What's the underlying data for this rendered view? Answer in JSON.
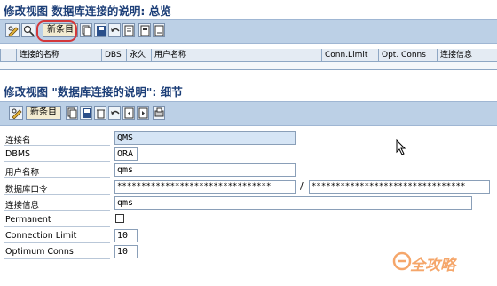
{
  "overview": {
    "title": "修改视图 数据库连接的说明: 总览",
    "new_entries_label": "新条目",
    "columns": [
      "连接的名称",
      "DBS",
      "永久",
      "用户名称",
      "Conn.Limit",
      "Opt. Conns",
      "连接信息"
    ]
  },
  "detail": {
    "title": "修改视图 \"数据库连接的说明\": 细节",
    "new_entries_label": "新条目",
    "connection_name_label": "连接名",
    "connection_name_value": "QMS",
    "dbms_label": "DBMS",
    "dbms_value": "ORA",
    "user_name_label": "用户名称",
    "user_name_value": "qms",
    "password_label": "数据库口令",
    "password_value": "********************************",
    "password_separator": "/",
    "password_confirm_value": "********************************",
    "connection_info_label": "连接信息",
    "connection_info_value": "qms",
    "permanent_label": "Permanent",
    "permanent_checked": false,
    "connection_limit_label": "Connection Limit",
    "connection_limit_value": "10",
    "optimum_conns_label": "Optimum Conns",
    "optimum_conns_value": "10"
  },
  "watermark": "全攻略",
  "colors": {
    "toolbar": "#bcd0e6",
    "title": "#1d3f78",
    "highlight_ring": "#d3373a"
  }
}
